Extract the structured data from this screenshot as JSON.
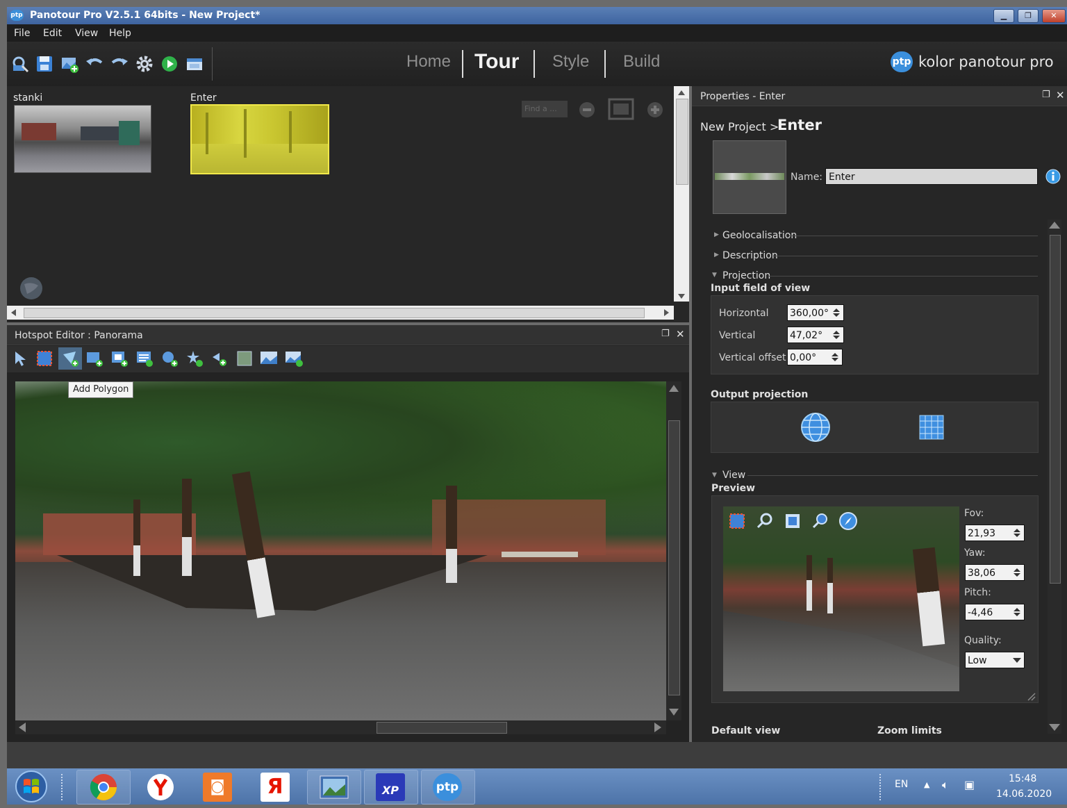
{
  "window": {
    "title": "Panotour Pro V2.5.1 64bits - New Project*",
    "app_icon_text": "ptp"
  },
  "menu": [
    "File",
    "Edit",
    "View",
    "Help"
  ],
  "nav_tabs": {
    "home": "Home",
    "tour": "Tour",
    "style": "Style",
    "build": "Build"
  },
  "brand": {
    "logo_text": "ptp",
    "name": "kolor panotour pro"
  },
  "tour": {
    "panoramas": [
      {
        "label": "stanki"
      },
      {
        "label": "Enter"
      }
    ],
    "find_placeholder": "Find a ..."
  },
  "hotspot_editor": {
    "title": "Hotspot Editor : Panorama",
    "tooltip": "Add Polygon"
  },
  "properties": {
    "panel_title": "Properties - Enter",
    "breadcrumb_parent": "New Project >",
    "breadcrumb_current": "Enter",
    "name_label": "Name:",
    "name_value": "Enter",
    "sections": {
      "geo": "Geolocalisation",
      "desc": "Description",
      "proj": "Projection",
      "view": "View"
    },
    "input_fov_title": "Input field of view",
    "horizontal_label": "Horizontal",
    "horizontal_value": "360,00°",
    "vertical_label": "Vertical",
    "vertical_value": "47,02°",
    "voffset_label": "Vertical offset",
    "voffset_value": "0,00°",
    "output_projection_title": "Output projection",
    "preview_title": "Preview",
    "fov_label": "Fov:",
    "fov_value": "21,93",
    "yaw_label": "Yaw:",
    "yaw_value": "38,06",
    "pitch_label": "Pitch:",
    "pitch_value": "-4,46",
    "quality_label": "Quality:",
    "quality_value": "Low",
    "default_view": "Default view",
    "zoom_limits": "Zoom limits"
  },
  "taskbar": {
    "lang": "EN",
    "time": "15:48",
    "date": "14.06.2020",
    "ptp_text": "ptp",
    "xp_text": "XP",
    "ya_text": "Я"
  }
}
